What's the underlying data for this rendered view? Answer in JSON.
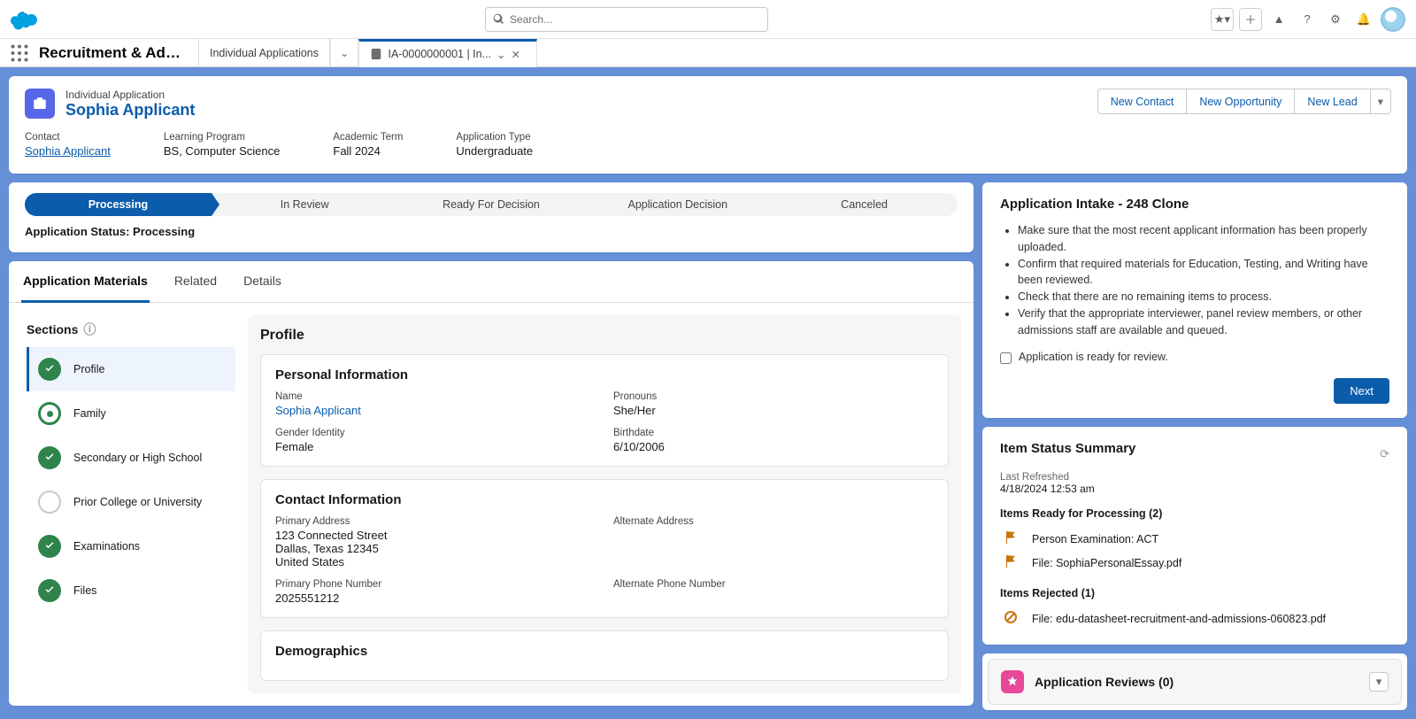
{
  "topbar": {
    "search_placeholder": "Search...",
    "app_name": "Recruitment & Adm...",
    "tabs": [
      {
        "label": "Individual Applications"
      },
      {
        "label": "IA-0000000001 | In..."
      }
    ]
  },
  "header": {
    "record_type": "Individual Application",
    "record_title": "Sophia Applicant",
    "actions": {
      "new_contact": "New Contact",
      "new_opportunity": "New Opportunity",
      "new_lead": "New Lead"
    },
    "fields": {
      "contact_label": "Contact",
      "contact_value": "Sophia Applicant",
      "program_label": "Learning Program",
      "program_value": "BS, Computer Science",
      "term_label": "Academic Term",
      "term_value": "Fall 2024",
      "type_label": "Application Type",
      "type_value": "Undergraduate"
    }
  },
  "path": {
    "stages": [
      "Processing",
      "In Review",
      "Ready For Decision",
      "Application Decision",
      "Canceled"
    ],
    "status_label": "Application Status: Processing"
  },
  "tabs": {
    "application_materials": "Application Materials",
    "related": "Related",
    "details": "Details"
  },
  "sections": {
    "header": "Sections",
    "items": [
      {
        "label": "Profile",
        "state": "done",
        "active": true
      },
      {
        "label": "Family",
        "state": "pending"
      },
      {
        "label": "Secondary or High School",
        "state": "done"
      },
      {
        "label": "Prior College or University",
        "state": "empty"
      },
      {
        "label": "Examinations",
        "state": "done"
      },
      {
        "label": "Files",
        "state": "done"
      }
    ]
  },
  "profile": {
    "title": "Profile",
    "personal": {
      "title": "Personal Information",
      "name_label": "Name",
      "name_value": "Sophia Applicant",
      "pronouns_label": "Pronouns",
      "pronouns_value": "She/Her",
      "gender_label": "Gender Identity",
      "gender_value": "Female",
      "birthdate_label": "Birthdate",
      "birthdate_value": "6/10/2006"
    },
    "contact": {
      "title": "Contact Information",
      "primary_addr_label": "Primary Address",
      "primary_addr_l1": "123 Connected Street",
      "primary_addr_l2": "Dallas, Texas 12345",
      "primary_addr_l3": "United States",
      "alt_addr_label": "Alternate Address",
      "primary_phone_label": "Primary Phone Number",
      "primary_phone_value": "2025551212",
      "alt_phone_label": "Alternate Phone Number"
    },
    "demographics_title": "Demographics"
  },
  "intake": {
    "title": "Application Intake - 248 Clone",
    "bullets": [
      "Make sure that the most recent applicant information has been properly uploaded.",
      "Confirm that required materials for Education, Testing, and Writing have been reviewed.",
      "Check that there are no remaining items to process.",
      "Verify that the appropriate interviewer, panel review members, or other admissions staff are available and queued."
    ],
    "checkbox_label": "Application is ready for review.",
    "next": "Next"
  },
  "item_status": {
    "title": "Item Status Summary",
    "last_refreshed_label": "Last Refreshed",
    "last_refreshed_value": "4/18/2024 12:53 am",
    "ready_header": "Items Ready for Processing (2)",
    "ready_items": [
      "Person Examination: ACT",
      "File: SophiaPersonalEssay.pdf"
    ],
    "rejected_header": "Items Rejected (1)",
    "rejected_items": [
      "File: edu-datasheet-recruitment-and-admissions-060823.pdf"
    ]
  },
  "reviews": {
    "title": "Application Reviews (0)"
  }
}
